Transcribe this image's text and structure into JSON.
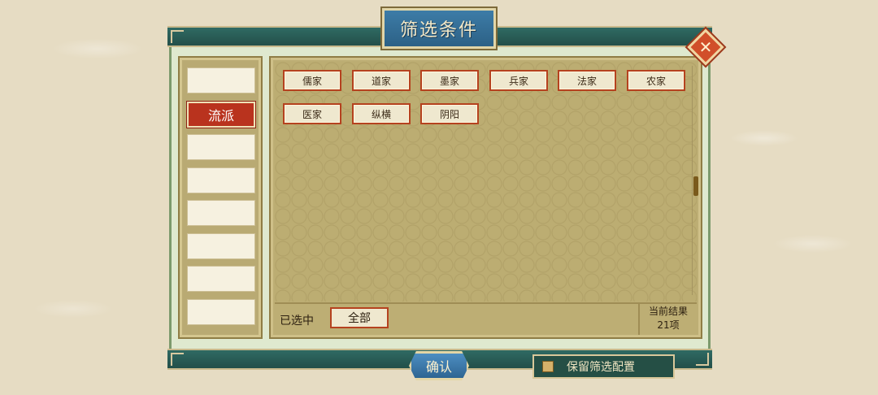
{
  "dialog": {
    "title": "筛选条件",
    "close_icon": "close-x-icon"
  },
  "tabs": [
    {
      "label": ""
    },
    {
      "label": "流派"
    },
    {
      "label": ""
    },
    {
      "label": ""
    },
    {
      "label": ""
    },
    {
      "label": ""
    },
    {
      "label": ""
    },
    {
      "label": ""
    }
  ],
  "options": [
    "儒家",
    "道家",
    "墨家",
    "兵家",
    "法家",
    "农家",
    "医家",
    "纵横",
    "阴阳"
  ],
  "footer": {
    "selected_label": "已选中",
    "selected_value": "全部",
    "result_title": "当前结果",
    "result_count": "21项"
  },
  "actions": {
    "confirm_label": "确认",
    "keep_filter_label": "保留筛选配置"
  },
  "colors": {
    "accent_red": "#b9331e",
    "teal_band": "#2f6a63",
    "title_blue": "#3d7ca7"
  }
}
